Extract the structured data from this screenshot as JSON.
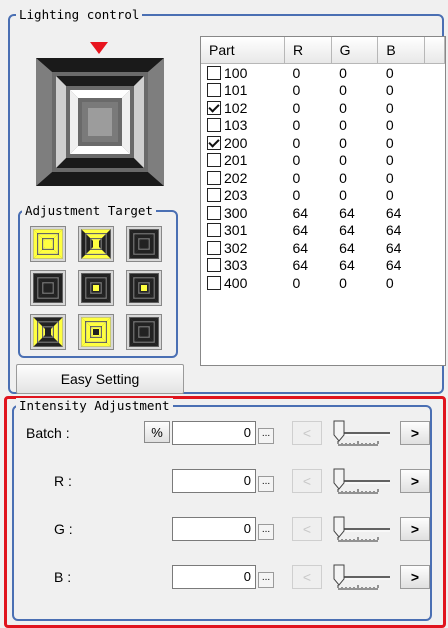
{
  "lighting_control": {
    "title": "Lighting control",
    "adjustment_target_title": "Adjustment Target",
    "easy_setting_label": "Easy Setting"
  },
  "part_table": {
    "headers": [
      "Part",
      "R",
      "G",
      "B"
    ],
    "rows": [
      {
        "part": "100",
        "checked": false,
        "r": "0",
        "g": "0",
        "b": "0"
      },
      {
        "part": "101",
        "checked": false,
        "r": "0",
        "g": "0",
        "b": "0"
      },
      {
        "part": "102",
        "checked": true,
        "r": "0",
        "g": "0",
        "b": "0"
      },
      {
        "part": "103",
        "checked": false,
        "r": "0",
        "g": "0",
        "b": "0"
      },
      {
        "part": "200",
        "checked": true,
        "r": "0",
        "g": "0",
        "b": "0"
      },
      {
        "part": "201",
        "checked": false,
        "r": "0",
        "g": "0",
        "b": "0"
      },
      {
        "part": "202",
        "checked": false,
        "r": "0",
        "g": "0",
        "b": "0"
      },
      {
        "part": "203",
        "checked": false,
        "r": "0",
        "g": "0",
        "b": "0"
      },
      {
        "part": "300",
        "checked": false,
        "r": "64",
        "g": "64",
        "b": "64"
      },
      {
        "part": "301",
        "checked": false,
        "r": "64",
        "g": "64",
        "b": "64"
      },
      {
        "part": "302",
        "checked": false,
        "r": "64",
        "g": "64",
        "b": "64"
      },
      {
        "part": "303",
        "checked": false,
        "r": "64",
        "g": "64",
        "b": "64"
      },
      {
        "part": "400",
        "checked": false,
        "r": "0",
        "g": "0",
        "b": "0"
      }
    ]
  },
  "intensity": {
    "title": "Intensity Adjustment",
    "percent_label": "%",
    "dots_label": "...",
    "dec_label": "<",
    "inc_label": ">",
    "rows": [
      {
        "label": "Batch :",
        "value": "0"
      },
      {
        "label": "R :",
        "value": "0"
      },
      {
        "label": "G :",
        "value": "0"
      },
      {
        "label": "B :",
        "value": "0"
      }
    ]
  },
  "colors": {
    "group_border": "#4a6fb3",
    "highlight": "#e0141e",
    "pointer": "#e8141e",
    "active_light": "#ffff40"
  }
}
